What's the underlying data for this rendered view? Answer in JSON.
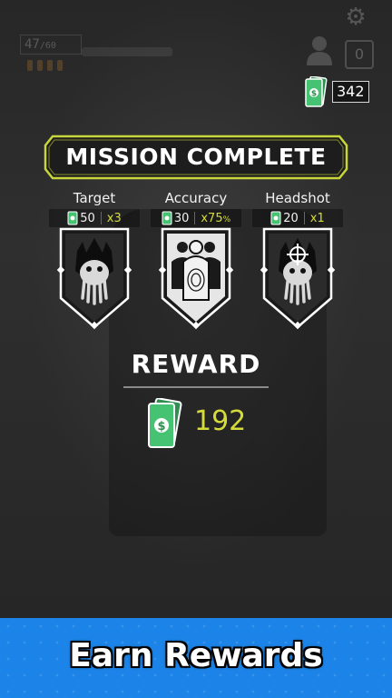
{
  "hud": {
    "ammo_current": "47",
    "ammo_max": "/60",
    "user_count": "0",
    "cash_balance": "342"
  },
  "mission": {
    "banner_text": "MISSION COMPLETE"
  },
  "stats": [
    {
      "label": "Target",
      "value": "50",
      "multiplier": "x3",
      "icon": "monster-target-icon"
    },
    {
      "label": "Accuracy",
      "value": "30",
      "multiplier": "x75",
      "multiplier_unit": "%",
      "icon": "shooting-targets-icon"
    },
    {
      "label": "Headshot",
      "value": "20",
      "multiplier": "x1",
      "icon": "crosshair-monster-icon"
    }
  ],
  "reward": {
    "title": "REWARD",
    "amount": "192"
  },
  "footer": {
    "caption": "Earn Rewards"
  },
  "colors": {
    "accent_yellow": "#d5dc3a",
    "cash_green": "#3fbf6a",
    "footer_blue": "#1c84e8"
  }
}
